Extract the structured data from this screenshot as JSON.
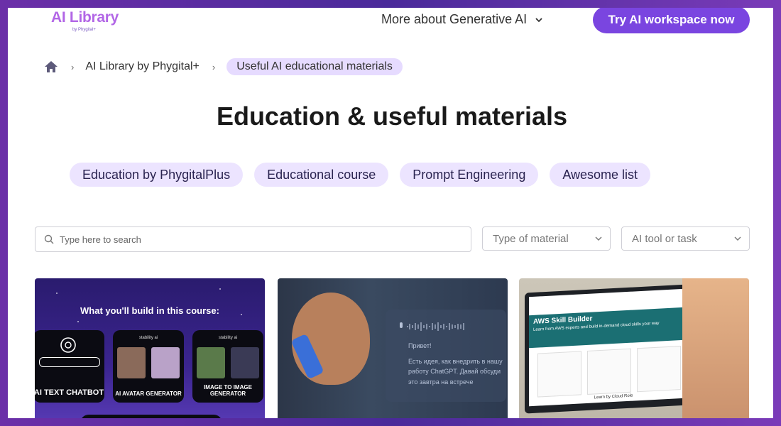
{
  "header": {
    "logo": {
      "title": "AI Library",
      "subtitle": "by Phygital+"
    },
    "nav_more": "More about Generative AI",
    "cta": "Try AI workspace now"
  },
  "breadcrumb": {
    "home_icon": "home-icon",
    "items": [
      "AI Library by Phygital+",
      "Useful AI educational materials"
    ]
  },
  "page_title": "Education & useful materials",
  "chips": [
    "Education by PhygitalPlus",
    "Educational course",
    "Prompt Engineering",
    "Awesome list"
  ],
  "filters": {
    "search_placeholder": "Type here to search",
    "material_select": "Type of material",
    "tool_select": "AI tool or task"
  },
  "cards": [
    {
      "heading": "What you'll build in this course:",
      "boxes": [
        {
          "sub": "",
          "label": "AI TEXT CHATBOT"
        },
        {
          "sub": "stability ai",
          "label": "AI AVATAR GENERATOR"
        },
        {
          "sub": "stability ai",
          "label": "IMAGE TO IMAGE GENERATOR"
        }
      ]
    },
    {
      "lines": [
        "Привет!",
        "Есть идея, как внедрить в нашу",
        "работу ChatGPT. Давай обсуди",
        "это завтра на встрече"
      ]
    },
    {
      "banner": "AWS Skill Builder",
      "banner_sub": "Learn from AWS experts and build in-demand cloud skills your way",
      "footer": "Learn by Cloud Role"
    }
  ],
  "colors": {
    "accent": "#7a45e0",
    "chip_bg": "#ece4ff",
    "logo": "#b266e6"
  }
}
